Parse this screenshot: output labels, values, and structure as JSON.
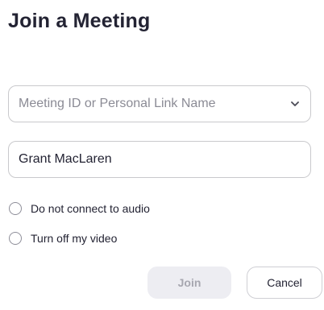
{
  "dialog": {
    "title": "Join a Meeting"
  },
  "meeting_id": {
    "placeholder": "Meeting ID or Personal Link Name",
    "value": ""
  },
  "name_field": {
    "value": "Grant MacLaren"
  },
  "options": {
    "audio_label": "Do not connect to audio",
    "video_label": "Turn off my video"
  },
  "buttons": {
    "join_label": "Join",
    "cancel_label": "Cancel"
  },
  "icons": {
    "dropdown": "chevron-down-icon"
  },
  "colors": {
    "text": "#232333",
    "placeholder": "#8b8b95",
    "border": "#c9c9cc",
    "join_bg_disabled": "#ededf2",
    "join_text_disabled": "#a7a7b0"
  }
}
